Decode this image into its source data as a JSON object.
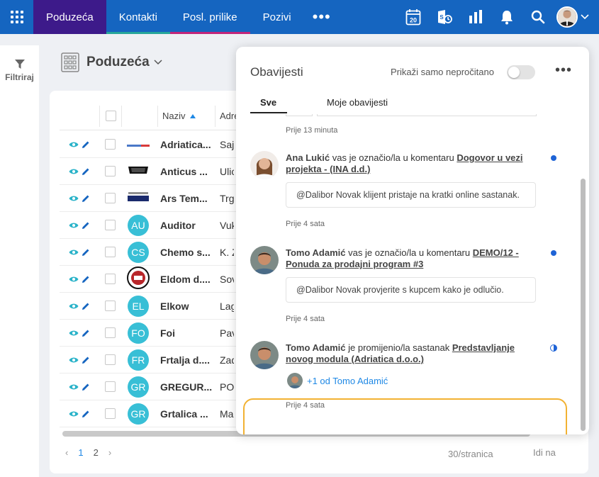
{
  "topnav": {
    "tabs": [
      {
        "label": "Poduzeća"
      },
      {
        "label": "Kontakti"
      },
      {
        "label": "Posl. prilike"
      },
      {
        "label": "Pozivi"
      }
    ],
    "calendar_day": "20",
    "icons": [
      "apps-grid-icon",
      "calendar-icon",
      "outlook-sync-icon",
      "reports-icon",
      "bell-icon",
      "search-icon",
      "user-avatar",
      "chevron-down-icon"
    ]
  },
  "sidebar": {
    "filter_label": "Filtriraj"
  },
  "page": {
    "title": "Poduzeća"
  },
  "table": {
    "headers": {
      "name": "Naziv",
      "address": "Adre"
    },
    "rows": [
      {
        "logo": "Adriatica logo",
        "badge": "",
        "name": "Adriatica...",
        "address": "Sajm"
      },
      {
        "logo": "Sixt logo",
        "badge": "",
        "name": "Anticus ...",
        "address": "Ulica"
      },
      {
        "logo": "Tempo logo",
        "badge": "",
        "name": "Ars Tem...",
        "address": "Trg L"
      },
      {
        "logo": "",
        "badge": "AU",
        "name": "Auditor",
        "address": "Vuko"
      },
      {
        "logo": "",
        "badge": "CS",
        "name": "Chemo s...",
        "address": "K. Zv"
      },
      {
        "logo": "Eldom logo",
        "badge": "",
        "name": "Eldom d....",
        "address": "Sovr"
      },
      {
        "logo": "",
        "badge": "EL",
        "name": "Elkow",
        "address": "Lagi"
      },
      {
        "logo": "",
        "badge": "FO",
        "name": "Foi",
        "address": "Pavl"
      },
      {
        "logo": "",
        "badge": "FR",
        "name": "Frtalja d....",
        "address": "Zada"
      },
      {
        "logo": "",
        "badge": "GR",
        "name": "GREGUR...",
        "address": "POL"
      },
      {
        "logo": "",
        "badge": "GR",
        "name": "Grtalica ...",
        "address": "Mari"
      }
    ]
  },
  "pager": {
    "pages": [
      "1",
      "2"
    ],
    "per_page": "30/stranica",
    "goto": "Idi na"
  },
  "notifications": {
    "title": "Obavijesti",
    "unread_toggle_label": "Prikaži samo nepročitano",
    "unread_only": false,
    "tabs": [
      {
        "label": "Sve"
      },
      {
        "label": "Moje obavijesti"
      }
    ],
    "first_time": "Prije 13 minuta",
    "items": [
      {
        "author": "Ana Lukić",
        "action": " vas je označio/la u komentaru ",
        "link": "Dogovor u vezi projekta - (INA d.d.)",
        "comment": "@Dalibor Novak klijent pristaje na kratki online sastanak.",
        "time": "Prije 4 sata",
        "status": "unread"
      },
      {
        "author": "Tomo Adamić",
        "action": " vas je označio/la u komentaru ",
        "link": "DEMO/12 - Ponuda za prodajni program #3",
        "comment": "@Dalibor Novak provjerite s kupcem kako je odlučio.",
        "time": "Prije 4 sata",
        "status": "unread"
      },
      {
        "author": "Tomo Adamić",
        "action": " je promijenio/la sastanak ",
        "link": "Predstavljanje novog modula (Adriatica d.o.o.)",
        "more": "+1 od Tomo Adamić",
        "time": "Prije 4 sata",
        "status": "partial"
      }
    ]
  },
  "colors": {
    "nav_blue": "#1565c0",
    "active_tab": "#3d1a8a",
    "badge_teal": "#38bfd6",
    "highlight": "#f2b233",
    "unread_dot": "#1e63d6"
  }
}
